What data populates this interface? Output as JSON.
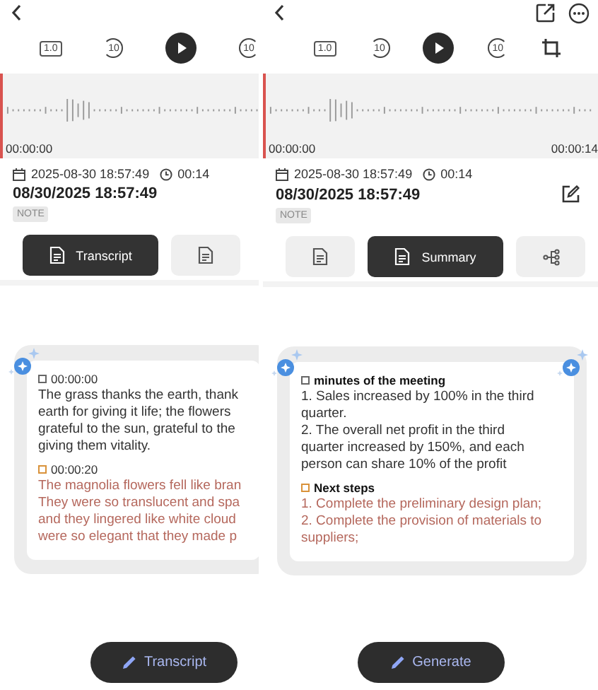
{
  "panels": [
    {
      "controls": [
        {
          "kind": "speed",
          "label": "1.0"
        },
        {
          "kind": "rewind",
          "label": "10"
        },
        {
          "kind": "play"
        },
        {
          "kind": "forward",
          "label": "10"
        }
      ],
      "waveform": {
        "start": "00:00:00"
      },
      "date": "2025-08-30 18:57:49",
      "duration": "00:14",
      "title": "08/30/2025 18:57:49",
      "tag": "NOTE",
      "editable": false,
      "tabs": [
        {
          "kind": "transcript",
          "label": "Transcript",
          "selected": true
        },
        {
          "kind": "summary",
          "selected": false
        }
      ],
      "card": {
        "badge_left": true,
        "sections": [
          {
            "kind": "time",
            "head": "00:00:00",
            "highlighted": false,
            "lines": [
              "The grass thanks the earth, thank",
              "earth for giving it life; the flowers",
              "grateful to the sun, grateful to the",
              "giving them vitality."
            ]
          },
          {
            "kind": "time",
            "head": "00:00:20",
            "highlighted": true,
            "lines": [
              "The magnolia flowers fell like bran",
              "They were so translucent and spa",
              "and they lingered like white cloud",
              "were so elegant that they made p"
            ]
          }
        ]
      },
      "action": {
        "label": "Transcript"
      }
    },
    {
      "top_actions": [
        {
          "kind": "share"
        },
        {
          "kind": "more"
        }
      ],
      "controls": [
        {
          "kind": "speed",
          "label": "1.0"
        },
        {
          "kind": "rewind",
          "label": "10"
        },
        {
          "kind": "play"
        },
        {
          "kind": "forward",
          "label": "10"
        },
        {
          "kind": "crop"
        }
      ],
      "waveform": {
        "start": "00:00:00",
        "end": "00:00:14"
      },
      "date": "2025-08-30 18:57:49",
      "duration": "00:14",
      "title": "08/30/2025 18:57:49",
      "tag": "NOTE",
      "editable": true,
      "tabs": [
        {
          "kind": "transcript",
          "selected": false
        },
        {
          "kind": "summary",
          "label": "Summary",
          "selected": true
        },
        {
          "kind": "mindmap",
          "selected": false
        }
      ],
      "card": {
        "badge_left": true,
        "badge_right": true,
        "sections": [
          {
            "kind": "heading",
            "head": "minutes of the meeting",
            "highlighted": false,
            "lines": [
              "1. Sales increased by 100% in the third",
              "quarter.",
              "2. The overall net profit in the third",
              "quarter increased by 150%, and each",
              "person can share 10% of the profit"
            ]
          },
          {
            "kind": "heading",
            "head": "Next steps",
            "highlighted": true,
            "lines": [
              "1. Complete the preliminary design plan;",
              "2. Complete the provision of materials to",
              "suppliers;"
            ]
          }
        ]
      },
      "action": {
        "label": "Generate"
      }
    }
  ]
}
